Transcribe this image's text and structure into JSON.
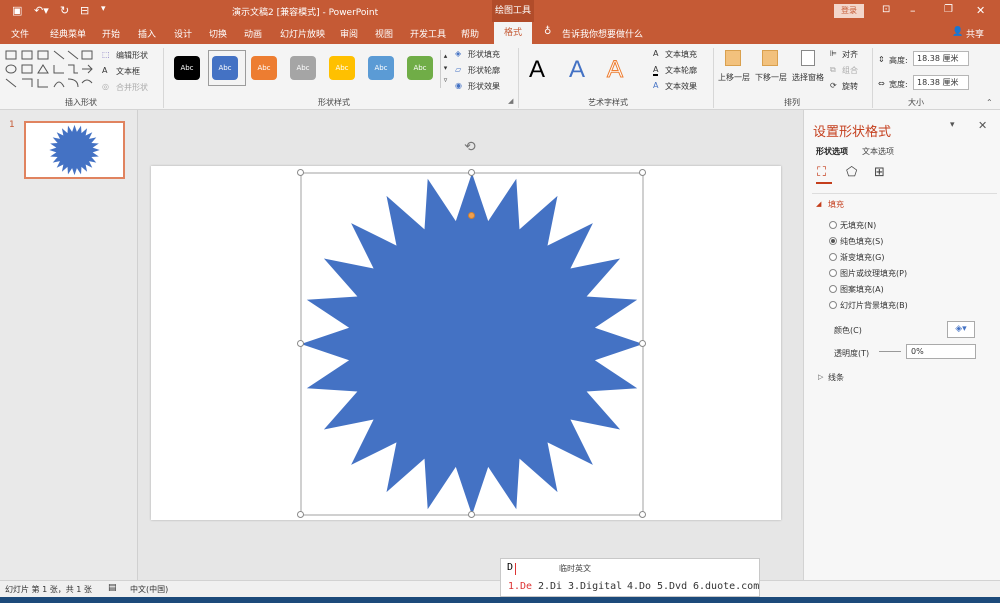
{
  "title_bar": {
    "doc_title": "演示文稿2 [兼容模式] - PowerPoint",
    "context_tool": "绘图工具",
    "login": "登录"
  },
  "tabs": [
    "文件",
    "经典菜单",
    "开始",
    "插入",
    "设计",
    "切换",
    "动画",
    "幻灯片放映",
    "审阅",
    "视图",
    "开发工具",
    "帮助",
    "格式"
  ],
  "active_tab": "格式",
  "tell_me": "告诉我你想要做什么",
  "share": "共享",
  "ribbon": {
    "insert_shapes": {
      "label": "插入形状",
      "edit_shape": "编辑形状",
      "text_box": "文本框",
      "merge_shapes": "合并形状"
    },
    "shape_styles": {
      "label": "形状样式",
      "swatches": [
        {
          "text": "Abc",
          "color": "#000000"
        },
        {
          "text": "Abc",
          "color": "#4472c4"
        },
        {
          "text": "Abc",
          "color": "#ed7d31"
        },
        {
          "text": "Abc",
          "color": "#a5a5a5"
        },
        {
          "text": "Abc",
          "color": "#ffc000"
        },
        {
          "text": "Abc",
          "color": "#5b9bd5"
        },
        {
          "text": "Abc",
          "color": "#70ad47"
        }
      ],
      "fill": "形状填充",
      "outline": "形状轮廓",
      "effects": "形状效果"
    },
    "wordart": {
      "label": "艺术字样式",
      "letters": [
        "A",
        "A",
        "A"
      ],
      "text_fill": "文本填充",
      "text_outline": "文本轮廓",
      "text_effects": "文本效果"
    },
    "arrange": {
      "label": "排列",
      "bring_forward": "上移一层",
      "send_backward": "下移一层",
      "selection_pane": "选择窗格",
      "align": "对齐",
      "group": "组合",
      "rotate": "旋转"
    },
    "size": {
      "label": "大小",
      "height_label": "高度:",
      "height_value": "18.38 厘米",
      "width_label": "宽度:",
      "width_value": "18.38 厘米"
    }
  },
  "thumbnail": {
    "number": "1"
  },
  "format_pane": {
    "title": "设置形状格式",
    "tab_shape": "形状选项",
    "tab_text": "文本选项",
    "fill_section": "填充",
    "options": [
      "无填充(N)",
      "纯色填充(S)",
      "渐变填充(G)",
      "图片或纹理填充(P)",
      "图案填充(A)",
      "幻灯片背景填充(B)"
    ],
    "selected_option": "纯色填充(S)",
    "color_label": "颜色(C)",
    "transparency_label": "透明度(T)",
    "transparency_value": "0%",
    "line_section": "线条"
  },
  "statusbar": {
    "slide_info": "幻灯片 第 1 张，共 1 张",
    "language": "中文(中国)"
  },
  "ime": {
    "input": "D",
    "mode": "临时英文",
    "candidates": [
      "1.De",
      "2.Di",
      "3.Digital",
      "4.Do",
      "5.Dvd",
      "6.duote.com"
    ]
  },
  "colors": {
    "accent": "#c55a35",
    "shape_fill": "#4472c4",
    "selection_red": "#c43e1c"
  }
}
